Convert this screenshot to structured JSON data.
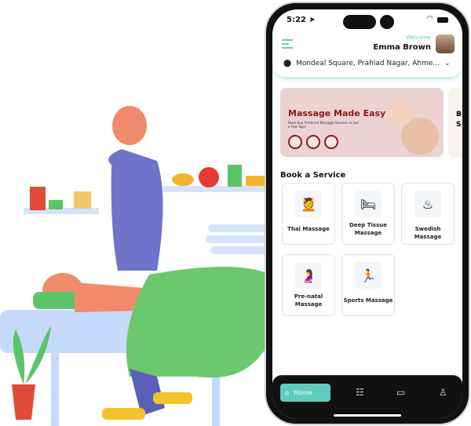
{
  "status": {
    "time": "5:22"
  },
  "header": {
    "welcome": "Welcome",
    "user_name": "Emma Brown",
    "location": "Mondeal Square, Prahlad Nagar, Ahme..."
  },
  "banner": {
    "title": "Massage Made Easy",
    "subtitle": "Book Your Preferred Massage Services in Just a Few Taps!",
    "next_partial": "B S"
  },
  "section_title": "Book a Service",
  "services": [
    {
      "label": "Thai Massage",
      "icon": "thai-massage-icon"
    },
    {
      "label": "Deep Tissue Massage",
      "icon": "deep-tissue-icon"
    },
    {
      "label": "Swedish Massage",
      "icon": "swedish-massage-icon"
    },
    {
      "label": "Pre-natal Massage",
      "icon": "prenatal-massage-icon"
    },
    {
      "label": "Sports Massage",
      "icon": "sports-massage-icon"
    }
  ],
  "nav": {
    "home": "Home"
  },
  "colors": {
    "accent": "#5ecdbe",
    "banner_title": "#8b1a1a"
  }
}
